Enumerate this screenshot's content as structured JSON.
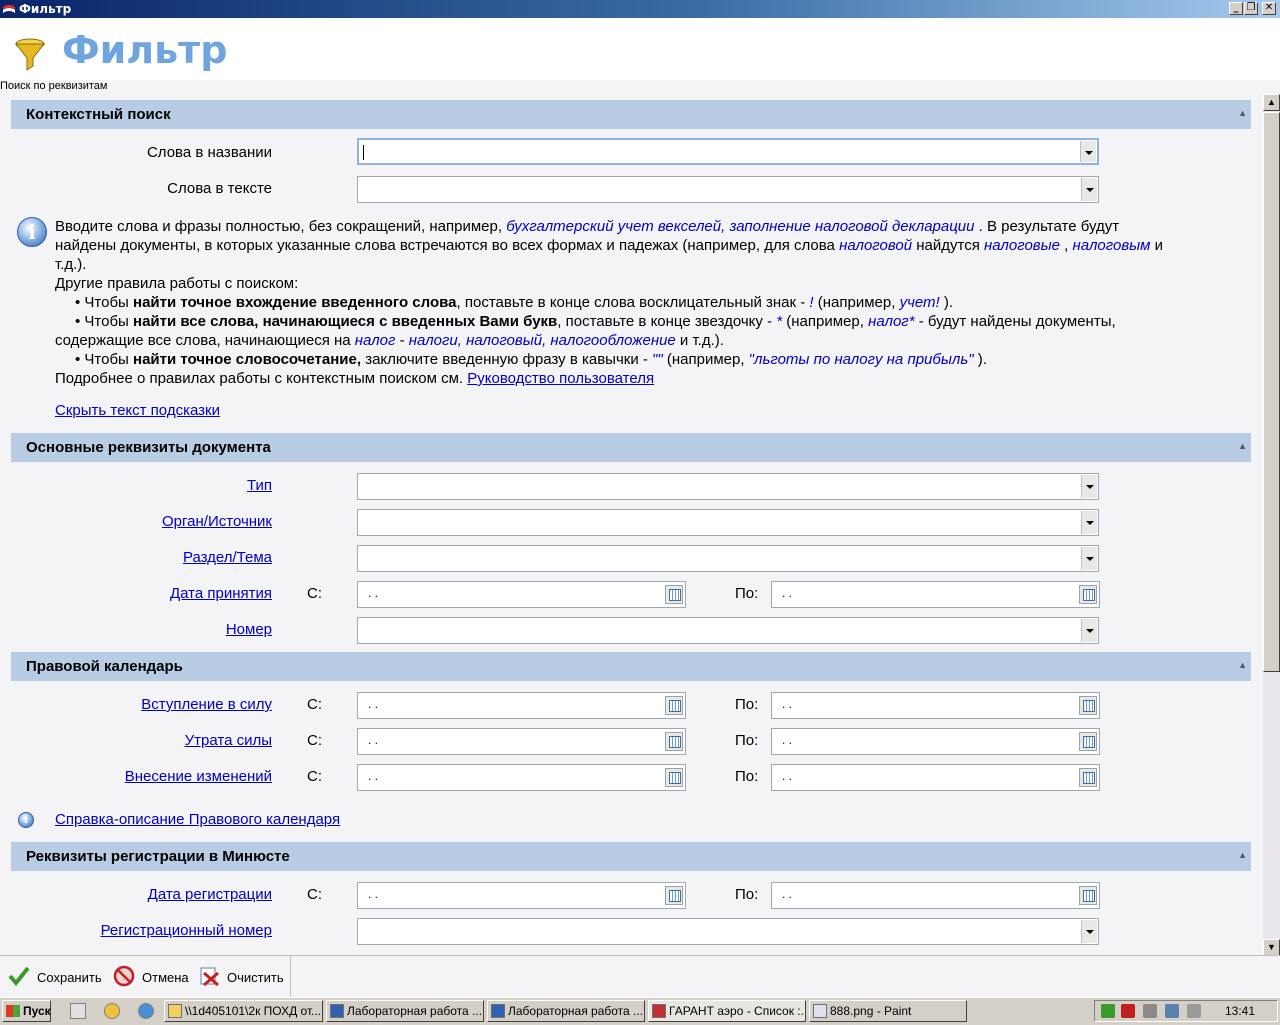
{
  "window": {
    "title": "Фильтр",
    "min": "_",
    "restore": "❐",
    "close": "✕"
  },
  "header": {
    "title": "Фильтр",
    "icon": "funnel-icon"
  },
  "breadcrumb": "Поиск по реквизитам",
  "sections": {
    "context": "Контекстный поиск",
    "main": "Основные реквизиты документа",
    "calendar": "Правовой календарь",
    "minjust": "Реквизиты регистрации в Минюсте"
  },
  "context": {
    "words_title_label": "Слова в названии",
    "words_text_label": "Слова в тексте"
  },
  "hint": {
    "l1a": "Вводите слова и фразы полностью, без сокращений, например, ",
    "l1b": "бухгалтерский учет векселей, заполнение налоговой декларации",
    "l1c": " . В результате будут",
    "l2a": "найдены документы, в которых указанные слова встречаются во всех формах и падежах (например, для слова ",
    "l2b": "налоговой",
    "l2c": " найдутся ",
    "l2d": "налоговые",
    "l2e": " , ",
    "l2f": "налоговым",
    "l2g": " и",
    "l3": "т.д.).",
    "l4": "Другие правила работы с поиском:",
    "r1a": "• Чтобы ",
    "r1b": "найти точное вхождение введенного слова",
    "r1c": ", поставьте в конце слова восклицательный знак - ",
    "r1d": "!",
    "r1e": " (например, ",
    "r1f": "учет!",
    "r1g": " ).",
    "r2a": "• Чтобы ",
    "r2b": "найти все слова, начинающиеся с введенных Вами букв",
    "r2c": ", поставьте в конце звездочку - ",
    "r2d": "*",
    "r2e": " (например, ",
    "r2f": "налог*",
    "r2g": " - будут найдены документы,",
    "r2h": "содержащие все слова, начинающиеся на ",
    "r2i": "налог",
    "r2j": " - ",
    "r2k": "налоги, налоговый, налогообложение",
    "r2l": " и т.д.).",
    "r3a": "• Чтобы ",
    "r3b": "найти точное словосочетание,",
    "r3c": " заключите введенную фразу в кавычки - ",
    "r3d": "\"\"",
    "r3e": " (например, ",
    "r3f": "\"льготы по налогу на прибыль\"",
    "r3g": " ).",
    "more_a": "Подробнее о правилах работы с контекстным поиском см. ",
    "more_link": "Руководство пользователя",
    "hide_link": "Скрыть текст подсказки"
  },
  "main": {
    "type": "Тип",
    "organ": "Орган/Источник",
    "section": "Раздел/Тема",
    "date": "Дата принятия",
    "number": "Номер"
  },
  "calendar": {
    "effective": "Вступление в силу",
    "lost": "Утрата силы",
    "changes": "Внесение изменений",
    "help_link": "Справка-описание Правового календаря"
  },
  "minjust": {
    "reg_date": "Дата регистрации",
    "reg_number": "Регистрационный номер"
  },
  "date_labels": {
    "from": "С:",
    "to": "По:",
    "empty": ". ."
  },
  "bottom": {
    "save": "Сохранить",
    "cancel": "Отмена",
    "clear": "Очистить"
  },
  "taskbar": {
    "start": "Пуск",
    "items": [
      "\\\\1d405101\\2к ПОХД от...",
      "Лабораторная работа ...",
      "Лабораторная работа ...",
      "ГАРАНТ аэро - Список :...",
      "888.png - Paint"
    ],
    "clock": "13:41"
  }
}
